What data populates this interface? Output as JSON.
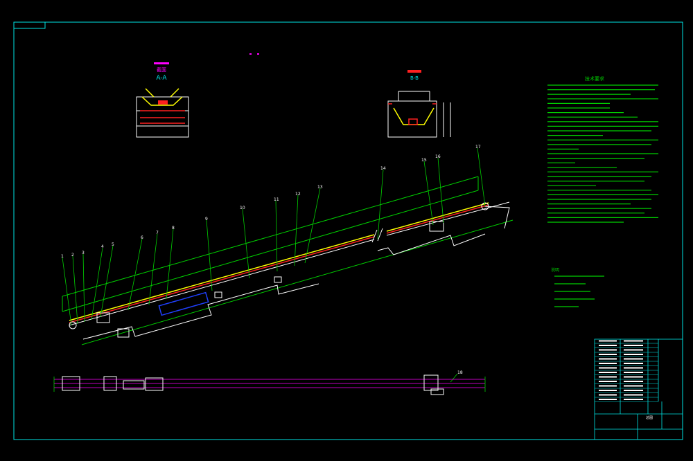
{
  "drawing": {
    "section_label": "A-A",
    "section_title": "截面",
    "right_section_label": "B-B",
    "tech_requirements_title": "技术要求",
    "notes_title": "说明",
    "balloons": [
      "1",
      "2",
      "3",
      "4",
      "5",
      "6",
      "7",
      "8",
      "9",
      "10",
      "11",
      "12",
      "13",
      "14",
      "15",
      "16",
      "17",
      "18"
    ],
    "title_block_label": "总图",
    "colors": {
      "frame": "#00e5e5",
      "green": "#00d000",
      "white": "#ffffff",
      "red": "#ff2020",
      "yellow": "#ffff00",
      "magenta": "#ff00ff",
      "blue": "#2040ff"
    }
  }
}
